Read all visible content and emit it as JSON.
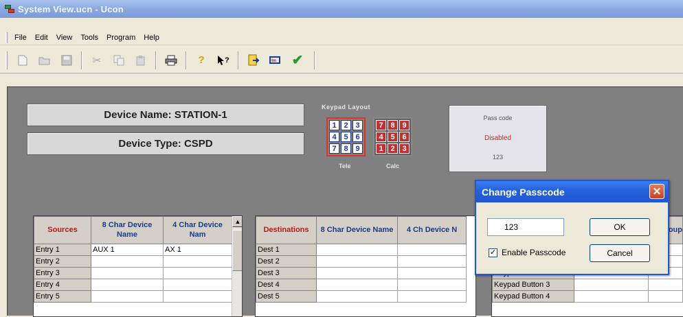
{
  "window": {
    "title": "System View.ucn - Ucon"
  },
  "menu": [
    "File",
    "Edit",
    "View",
    "Tools",
    "Program",
    "Help"
  ],
  "toolbar": {
    "icons": [
      "new-icon",
      "open-icon",
      "save-icon",
      "cut-icon",
      "copy-icon",
      "paste-icon",
      "print-icon",
      "help-icon",
      "context-help-icon",
      "export-icon",
      "import-icon",
      "check-icon"
    ]
  },
  "device": {
    "name": "Device Name: STATION-1",
    "type": "Device Type: CSPD"
  },
  "keypad": {
    "title": "Keypad Layout",
    "tele_label": "Tele",
    "calc_label": "Calc",
    "tele_keys": [
      "1",
      "2",
      "3",
      "4",
      "5",
      "6",
      "7",
      "8",
      "9"
    ],
    "calc_keys": [
      "7",
      "8",
      "9",
      "4",
      "5",
      "6",
      "1",
      "2",
      "3"
    ]
  },
  "passcode_panel": {
    "label": "Pass code",
    "status": "Disabled",
    "value": "123",
    "status_color": "#cc2222"
  },
  "sources": {
    "header": "Sources",
    "col1": "8 Char Device Name",
    "col2": "4 Char Device Nam",
    "rows": [
      {
        "entry": "Entry 1",
        "name8": "AUX  1",
        "name4": "AX 1"
      },
      {
        "entry": "Entry 2",
        "name8": "",
        "name4": ""
      },
      {
        "entry": "Entry 3",
        "name8": "",
        "name4": ""
      },
      {
        "entry": "Entry 4",
        "name8": "",
        "name4": ""
      },
      {
        "entry": "Entry 5",
        "name8": "",
        "name4": ""
      }
    ]
  },
  "destinations": {
    "header": "Destinations",
    "col1": "8 Char Device Name",
    "col2": "4 Ch Device N",
    "rows": [
      {
        "entry": "Dest 1",
        "name8": "",
        "name4": ""
      },
      {
        "entry": "Dest 2",
        "name8": "",
        "name4": ""
      },
      {
        "entry": "Dest 3",
        "name8": "",
        "name4": ""
      },
      {
        "entry": "Dest 4",
        "name8": "",
        "name4": ""
      },
      {
        "entry": "Dest 5",
        "name8": "",
        "name4": ""
      }
    ]
  },
  "ports": {
    "header_partial": "ort oup",
    "rows": [
      "Keypad Button 2",
      "Keypad Button 3",
      "Keypad Button 4"
    ]
  },
  "dialog": {
    "title": "Change Passcode",
    "input_value": "123",
    "ok_label": "OK",
    "cancel_label": "Cancel",
    "checkbox_label": "Enable Passcode",
    "checkbox_checked": true
  }
}
